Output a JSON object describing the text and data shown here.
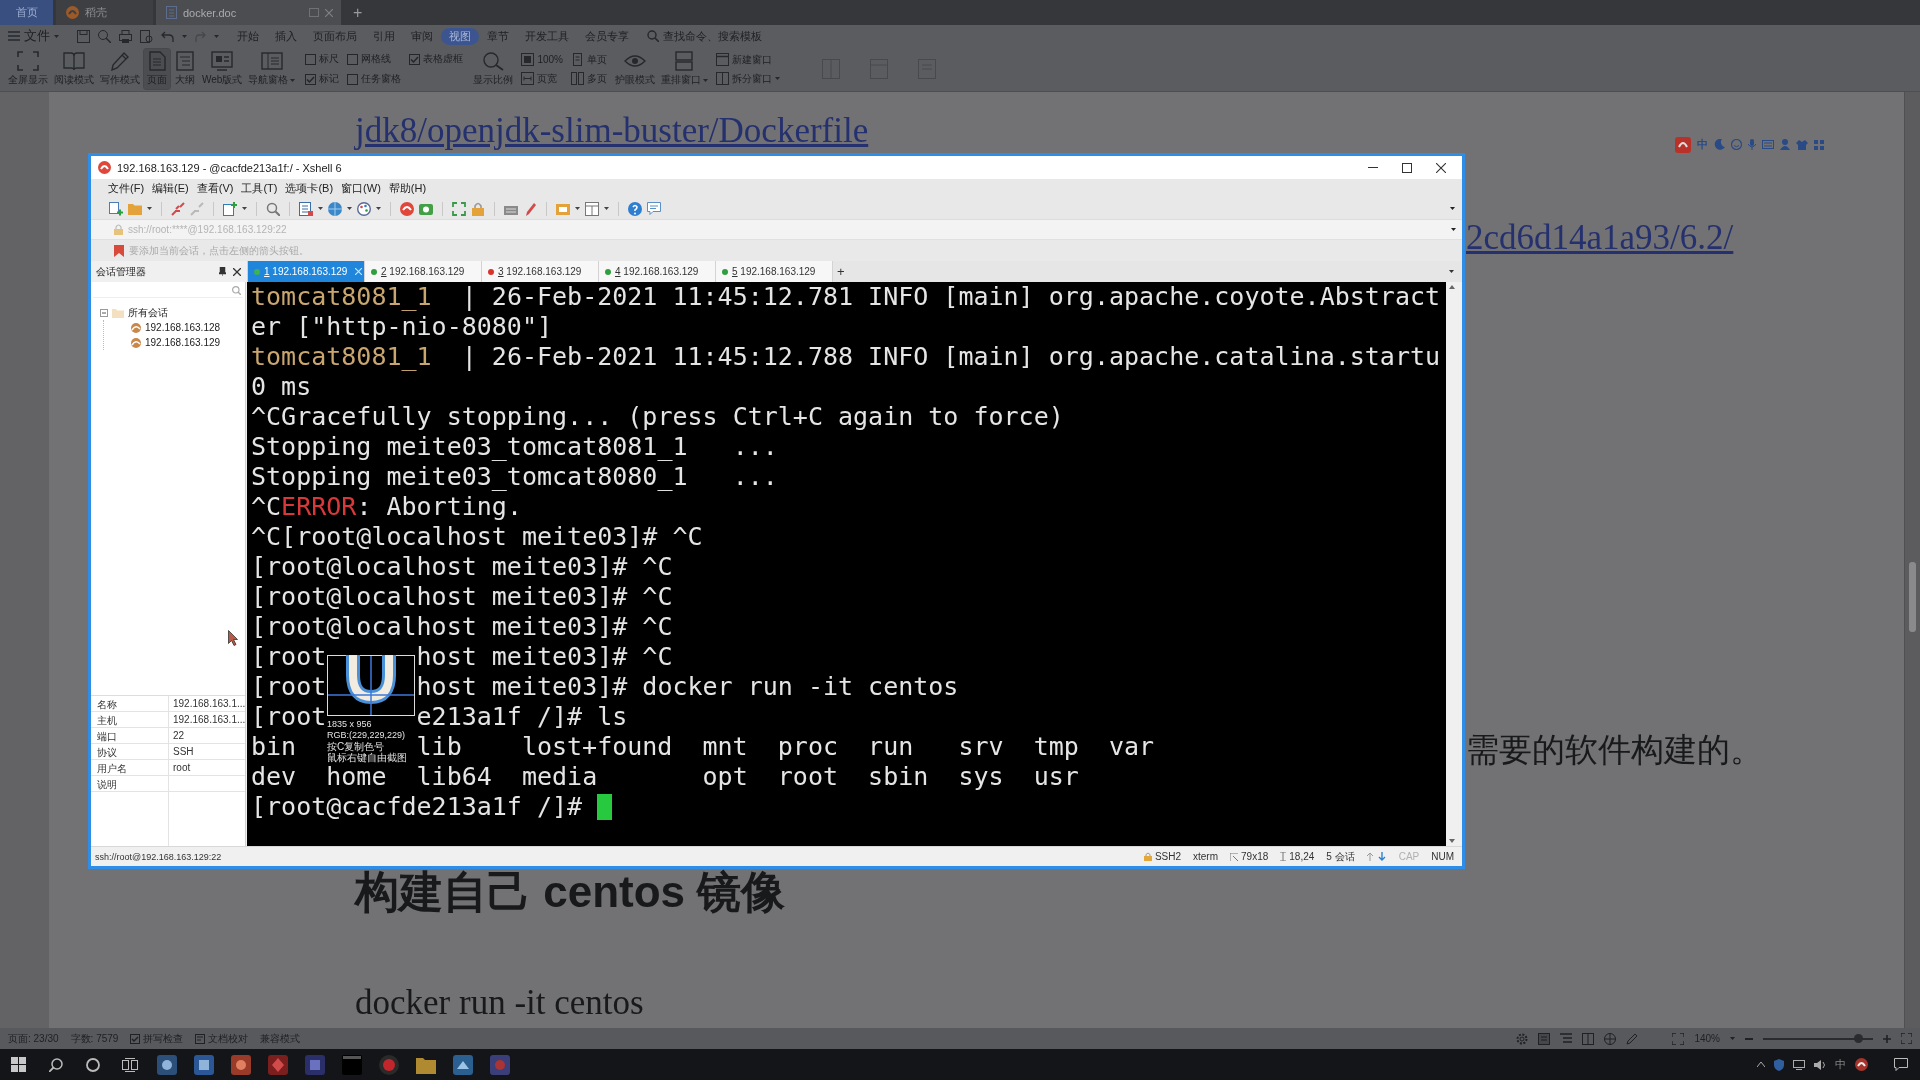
{
  "wps": {
    "home_tab": "首页",
    "tabs": [
      {
        "kind": "app",
        "label": "稻壳",
        "selected": false
      },
      {
        "kind": "document",
        "label": "docker.doc",
        "selected": true
      }
    ],
    "new_tab": "+",
    "file_menu": "文件",
    "menu": [
      {
        "label": "开始",
        "selected": false
      },
      {
        "label": "插入",
        "selected": false
      },
      {
        "label": "页面布局",
        "selected": false
      },
      {
        "label": "引用",
        "selected": false
      },
      {
        "label": "审阅",
        "selected": false
      },
      {
        "label": "视图",
        "selected": true
      },
      {
        "label": "章节",
        "selected": false
      },
      {
        "label": "开发工具",
        "selected": false
      },
      {
        "label": "会员专享",
        "selected": false
      }
    ],
    "search": {
      "placeholder": "查找命令、搜索模板"
    },
    "ribbon": [
      {
        "kind": "large",
        "label": "全屏显示",
        "selected": false,
        "dropdown": false
      },
      {
        "kind": "large",
        "label": "阅读模式",
        "selected": false,
        "dropdown": false
      },
      {
        "kind": "large",
        "label": "写作模式",
        "selected": false,
        "dropdown": false
      },
      {
        "kind": "large",
        "label": "页面",
        "selected": true,
        "dropdown": false
      },
      {
        "kind": "large",
        "label": "大纲",
        "selected": false,
        "dropdown": false
      },
      {
        "kind": "large",
        "label": "Web版式",
        "selected": false,
        "dropdown": false
      },
      {
        "kind": "large",
        "label": "导航窗格",
        "selected": false,
        "dropdown": true
      },
      {
        "kind": "checks",
        "items": [
          {
            "label": "标尺",
            "checked": false
          },
          {
            "label": "网格线",
            "checked": false
          },
          {
            "label": "表格虚框",
            "checked": true
          },
          {
            "label": "标记",
            "checked": true
          },
          {
            "label": "任务窗格",
            "checked": false
          }
        ]
      },
      {
        "kind": "large",
        "label": "显示比例",
        "selected": false,
        "dropdown": false
      },
      {
        "kind": "smalls",
        "items": [
          {
            "label": "100%",
            "dropdown": false
          },
          {
            "label": "页宽",
            "dropdown": false
          },
          {
            "label": "单页",
            "dropdown": false
          },
          {
            "label": "多页",
            "dropdown": false
          }
        ]
      },
      {
        "kind": "large",
        "label": "护眼模式",
        "selected": false,
        "dropdown": false
      },
      {
        "kind": "large",
        "label": "重排窗口",
        "selected": false,
        "dropdown": true
      },
      {
        "kind": "smalls",
        "items": [
          {
            "label": "新建窗口",
            "dropdown": false
          },
          {
            "label": "拆分窗口",
            "dropdown": true
          }
        ]
      }
    ]
  },
  "document": {
    "link": "jdk8/openjdk-slim-buster/Dockerfile",
    "link_tail": "2cd6d14a1a93/6.2/",
    "text_tail": "需要的软件构建的。",
    "heading": "构建自己 centos 镜像",
    "command": "docker run -it centos"
  },
  "wps_status": {
    "items": [
      {
        "kind": "text",
        "label": "页面: 23/30"
      },
      {
        "kind": "text",
        "label": "字数: 7579"
      },
      {
        "kind": "check",
        "label": "拼写检查",
        "checked": true
      },
      {
        "kind": "icon",
        "label": "文档校对"
      },
      {
        "kind": "text",
        "label": "兼容模式"
      }
    ],
    "zoom": "140%",
    "zoom_slider": {
      "level": 0.86
    }
  },
  "ime_bar": {
    "mode": "中"
  },
  "taskbar": {
    "tray_ime": "中"
  },
  "xshell": {
    "title": "192.168.163.129 - @cacfde213a1f:/ - Xshell 6",
    "menu": [
      "文件(F)",
      "编辑(E)",
      "查看(V)",
      "工具(T)",
      "选项卡(B)",
      "窗口(W)",
      "帮助(H)"
    ],
    "address": "ssh://root:****@192.168.163.129:22",
    "hint": "要添加当前会话，点击左侧的箭头按钮。",
    "sessions": {
      "title": "会话管理器",
      "tree": [
        {
          "label": "所有会话",
          "expanded": true,
          "children": [
            {
              "label": "192.168.163.128"
            },
            {
              "label": "192.168.163.129"
            }
          ]
        }
      ],
      "properties": [
        {
          "name": "名称",
          "value": "192.168.163.1..."
        },
        {
          "name": "主机",
          "value": "192.168.163.1..."
        },
        {
          "name": "端口",
          "value": "22"
        },
        {
          "name": "协议",
          "value": "SSH"
        },
        {
          "name": "用户名",
          "value": "root"
        },
        {
          "name": "说明"
        }
      ]
    },
    "tabs": [
      {
        "number": "1",
        "label": "192.168.163.129",
        "selected": true,
        "color": "#3fb34f"
      },
      {
        "number": "2",
        "label": "192.168.163.129",
        "selected": false,
        "color": "#2f9e3f"
      },
      {
        "number": "3",
        "label": "192.168.163.129",
        "selected": false,
        "color": "#d9342b"
      },
      {
        "number": "4",
        "label": "192.168.163.129",
        "selected": false,
        "color": "#2f9e3f"
      },
      {
        "number": "5",
        "label": "192.168.163.129",
        "selected": false,
        "color": "#2f9e3f"
      }
    ],
    "new_tab": "+",
    "terminal": {
      "lines": [
        [
          {
            "kind": "container",
            "text": "tomcat8081_1"
          },
          {
            "kind": "plain",
            "text": "  | 26-Feb-2021 11:45:12.781 INFO [main] org.apache.coyote.Abstract"
          }
        ],
        [
          {
            "kind": "plain",
            "text": "er [\"http-nio-8080\"]"
          }
        ],
        [
          {
            "kind": "container",
            "text": "tomcat8081_1"
          },
          {
            "kind": "plain",
            "text": "  | 26-Feb-2021 11:45:12.788 INFO [main] org.apache.catalina.startu"
          }
        ],
        [
          {
            "kind": "plain",
            "text": "0 ms"
          }
        ],
        [
          {
            "kind": "plain",
            "text": "^CGracefully stopping... (press Ctrl+C again to force)"
          }
        ],
        [
          {
            "kind": "plain",
            "text": "Stopping meite03_tomcat8081_1   ..."
          }
        ],
        [
          {
            "kind": "plain",
            "text": "Stopping meite03_tomcat8080_1   ..."
          }
        ],
        [
          {
            "kind": "plain",
            "text": "^C"
          },
          {
            "kind": "error",
            "text": "ERROR"
          },
          {
            "kind": "plain",
            "text": ": Aborting."
          }
        ],
        [
          {
            "kind": "plain",
            "text": "^C[root@localhost meite03]# ^C"
          }
        ],
        [
          {
            "kind": "plain",
            "text": "[root@localhost meite03]# ^C"
          }
        ],
        [
          {
            "kind": "plain",
            "text": "[root@localhost meite03]# ^C"
          }
        ],
        [
          {
            "kind": "plain",
            "text": "[root@localhost meite03]# ^C"
          }
        ],
        [
          {
            "kind": "plain",
            "text": "[root"
          },
          {
            "kind": "covered"
          },
          {
            "kind": "plain",
            "text": "host meite03]# ^C"
          }
        ],
        [
          {
            "kind": "plain",
            "text": "[root"
          },
          {
            "kind": "covered"
          },
          {
            "kind": "plain",
            "text": "host meite03]# docker run -it centos"
          }
        ],
        [
          {
            "kind": "plain",
            "text": "[root"
          },
          {
            "kind": "covered"
          },
          {
            "kind": "plain",
            "text": "e213a1f /]# ls"
          }
        ],
        [
          {
            "kind": "plain",
            "text": "bin"
          },
          {
            "kind": "covered"
          },
          {
            "kind": "plain",
            "text": "lib    lost+found  mnt  proc  run   srv  tmp  var"
          }
        ],
        [
          {
            "kind": "plain",
            "text": "dev  home  lib64  media       opt  root  sbin  sys  usr"
          }
        ],
        [
          {
            "kind": "plain",
            "text": "[root@cacfde213a1f /]# "
          },
          {
            "kind": "cursor"
          }
        ]
      ]
    },
    "status": {
      "path": "ssh://root@192.168.163.129:22",
      "items": [
        {
          "kind": "protocol",
          "label": "SSH2"
        },
        {
          "kind": "text",
          "label": "xterm"
        },
        {
          "kind": "size",
          "label": "79x18"
        },
        {
          "kind": "position",
          "label": "18,24"
        },
        {
          "kind": "text",
          "label": "5 会话"
        },
        {
          "kind": "transfer"
        }
      ],
      "keys": [
        {
          "label": "CAP",
          "on": false
        },
        {
          "label": "NUM",
          "on": true
        }
      ]
    }
  },
  "capture_overlay": {
    "size": "1835 x 956",
    "rgb": "RGB:(229,229,229)",
    "hints": [
      "按C复制色号",
      "鼠标右键自由截图"
    ]
  }
}
